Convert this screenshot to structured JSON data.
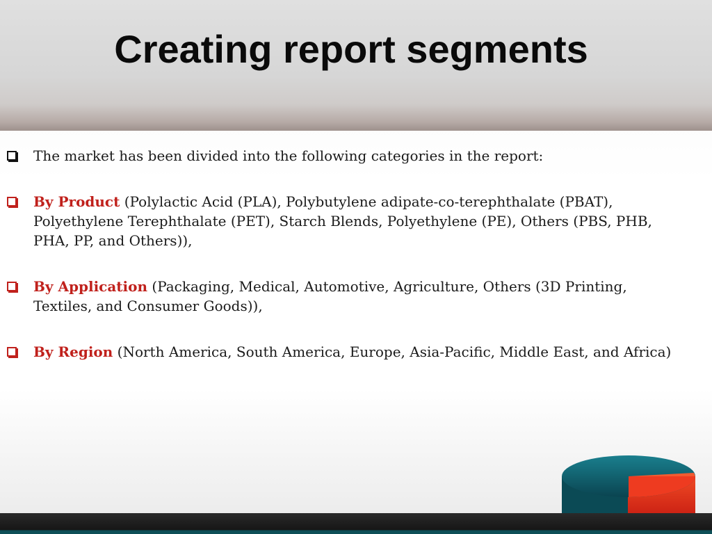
{
  "slide": {
    "title": "Creating report segments",
    "bullets": [
      {
        "category": "",
        "text": "The market has been divided into the following categories in the report:"
      },
      {
        "category": "By Product",
        "text": " (Polylactic Acid (PLA), Polybutylene adipate-co-terephthalate (PBAT), Polyethylene Terephthalate (PET), Starch Blends, Polyethylene (PE), Others (PBS, PHB, PHA, PP, and Others)),"
      },
      {
        "category": "By Application",
        "text": " (Packaging, Medical, Automotive, Agriculture, Others (3D Printing, Textiles, and Consumer Goods)),"
      },
      {
        "category": "By Region",
        "text": " (North America, South America, Europe, Asia-Pacific, Middle East, and Africa)"
      }
    ]
  },
  "colors": {
    "accent": "#c0211c",
    "pie_teal": "#0e5e6b",
    "pie_red": "#e5301d",
    "footer_band": "#0e4f57"
  },
  "icons": {
    "bullet": "checkbox-square-icon",
    "logo": "pie-chart-logo-icon"
  }
}
